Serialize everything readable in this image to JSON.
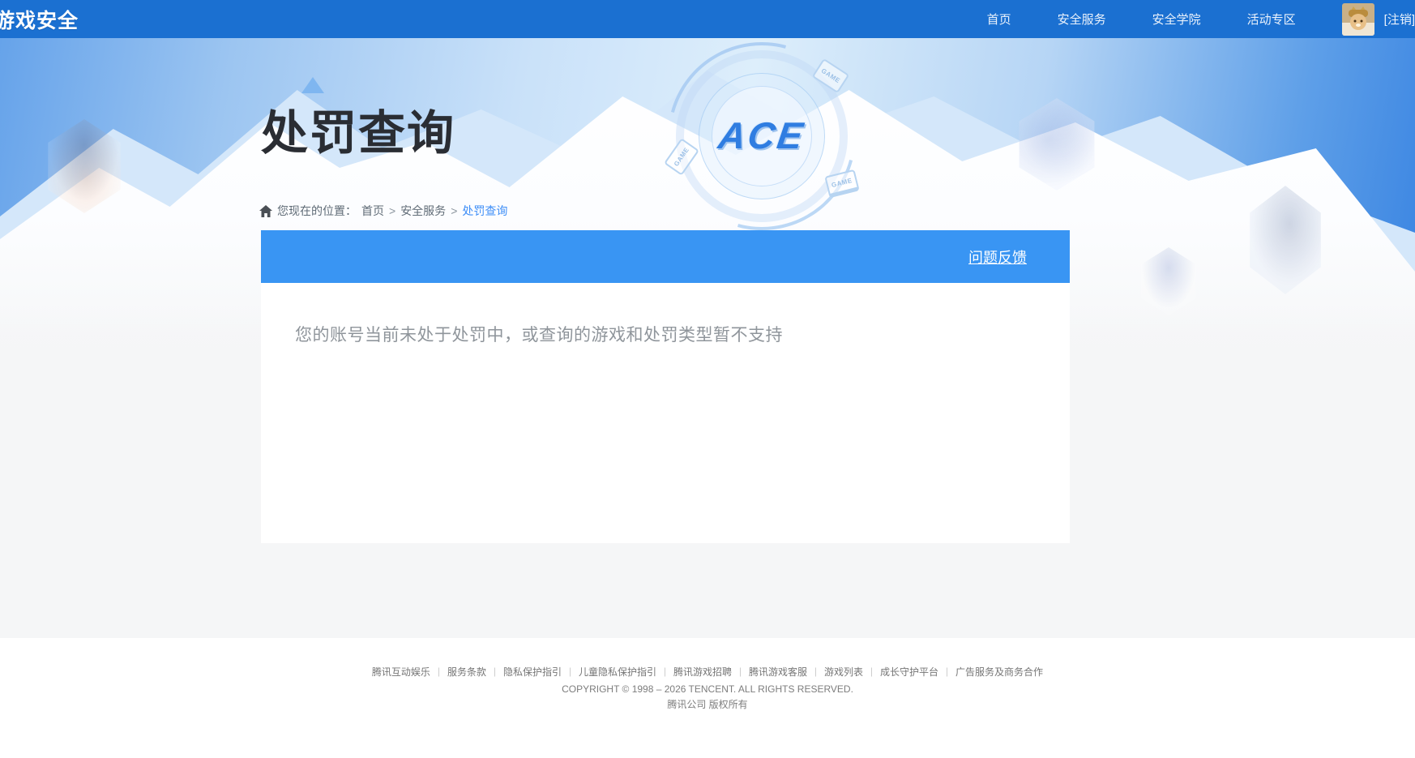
{
  "nav": {
    "logo": "游戏安全",
    "items": [
      {
        "label": "首页"
      },
      {
        "label": "安全服务"
      },
      {
        "label": "安全学院"
      },
      {
        "label": "活动专区"
      }
    ],
    "logout_label": "[注销]"
  },
  "banner": {
    "emblem_text": "ACE",
    "game_tag": "GAME"
  },
  "page": {
    "title": "处罚查询",
    "breadcrumb": {
      "prefix": "您现在的位置：",
      "items": [
        "首页",
        "安全服务"
      ],
      "separator": ">",
      "current": "处罚查询"
    }
  },
  "panel": {
    "feedback_link": "问题反馈",
    "message": "您的账号当前未处于处罚中，或查询的游戏和处罚类型暂不支持"
  },
  "footer": {
    "links": [
      "腾讯互动娱乐",
      "服务条款",
      "隐私保护指引",
      "儿童隐私保护指引",
      "腾讯游戏招聘",
      "腾讯游戏客服",
      "游戏列表",
      "成长守护平台",
      "广告服务及商务合作"
    ],
    "copyright": "COPYRIGHT © 1998 – 2026 TENCENT. ALL RIGHTS RESERVED.",
    "company": "腾讯公司 版权所有"
  },
  "colors": {
    "nav_bg": "#1b70d1",
    "panel_header_bg": "#3995f3",
    "breadcrumb_current": "#3e8ef7",
    "page_bg": "#f5f6f7",
    "message_text": "#8f959b"
  }
}
